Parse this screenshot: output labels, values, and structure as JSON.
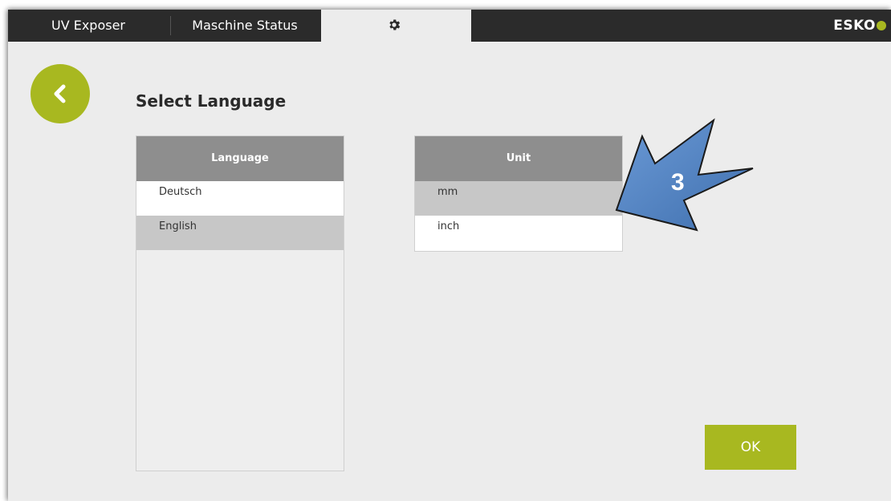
{
  "tabs": {
    "uv_exposer": "UV Exposer",
    "maschine_status": "Maschine Status"
  },
  "logo": {
    "text": "ESKO"
  },
  "page": {
    "title": "Select Language"
  },
  "language_list": {
    "header": "Language",
    "items": [
      {
        "label": "Deutsch",
        "selected": false
      },
      {
        "label": "English",
        "selected": true
      }
    ]
  },
  "unit_list": {
    "header": "Unit",
    "items": [
      {
        "label": "mm",
        "selected": true
      },
      {
        "label": "inch",
        "selected": false
      }
    ]
  },
  "ok_button": {
    "label": "OK"
  },
  "annotation": {
    "label": "3"
  },
  "colors": {
    "accent": "#a8b820",
    "topbar": "#2b2b2b",
    "arrow": "#4a7fc1"
  }
}
